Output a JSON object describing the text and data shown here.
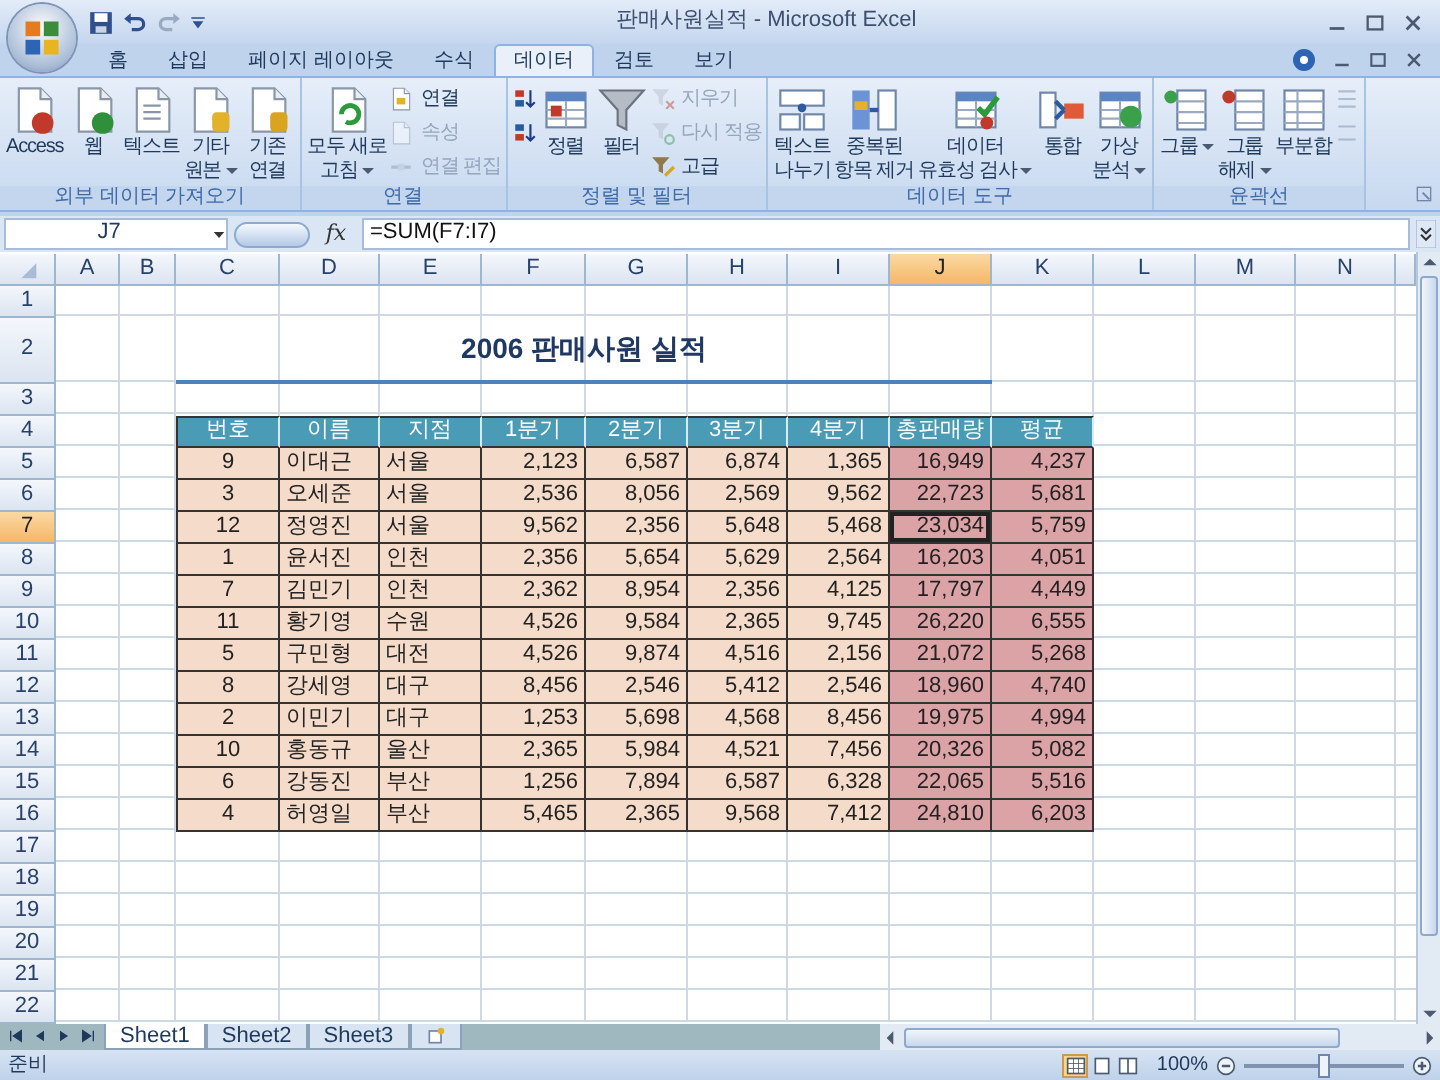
{
  "window": {
    "title": "판매사원실적 - Microsoft Excel"
  },
  "ribbon_tabs": [
    {
      "label": "홈",
      "selected": false
    },
    {
      "label": "삽입",
      "selected": false
    },
    {
      "label": "페이지 레이아웃",
      "selected": false
    },
    {
      "label": "수식",
      "selected": false
    },
    {
      "label": "데이터",
      "selected": true
    },
    {
      "label": "검토",
      "selected": false
    },
    {
      "label": "보기",
      "selected": false
    }
  ],
  "ribbon_groups": [
    {
      "label": "외부 데이터 가져오기",
      "items": [
        {
          "kind": "large",
          "label": "Access",
          "dropdown": false
        },
        {
          "kind": "large",
          "label": "웹",
          "dropdown": false
        },
        {
          "kind": "large",
          "label": "텍스트",
          "dropdown": false
        },
        {
          "kind": "large",
          "label": "기타\n원본",
          "dropdown": true
        },
        {
          "kind": "large",
          "label": "기존\n연결",
          "dropdown": false
        }
      ]
    },
    {
      "label": "연결",
      "items": [
        {
          "kind": "large",
          "label": "모두 새로\n고침",
          "dropdown": true
        },
        {
          "kind": "stack",
          "buttons": [
            {
              "label": "연결",
              "disabled": false
            },
            {
              "label": "속성",
              "disabled": true
            },
            {
              "label": "연결 편집",
              "disabled": true
            }
          ]
        }
      ]
    },
    {
      "label": "정렬 및 필터",
      "items": [
        {
          "kind": "stack",
          "buttons": [
            {
              "disabled": false
            },
            {
              "disabled": false
            }
          ]
        },
        {
          "kind": "large",
          "label": "정렬",
          "dropdown": false
        },
        {
          "kind": "large",
          "label": "필터",
          "dropdown": false
        },
        {
          "kind": "stack",
          "buttons": [
            {
              "label": "지우기",
              "disabled": true
            },
            {
              "label": "다시 적용",
              "disabled": true
            },
            {
              "label": "고급",
              "disabled": false
            }
          ]
        }
      ]
    },
    {
      "label": "데이터 도구",
      "items": [
        {
          "kind": "large",
          "label": "텍스트\n나누기",
          "dropdown": false
        },
        {
          "kind": "large",
          "label": "중복된\n항목 제거",
          "dropdown": false
        },
        {
          "kind": "large",
          "label": "데이터\n유효성 검사",
          "dropdown": true
        },
        {
          "kind": "large",
          "label": "통합",
          "dropdown": false
        },
        {
          "kind": "large",
          "label": "가상\n분석",
          "dropdown": true
        }
      ]
    },
    {
      "label": "윤곽선",
      "items": [
        {
          "kind": "large",
          "label": "그룹",
          "dropdown": true
        },
        {
          "kind": "large",
          "label": "그룹\n해제",
          "dropdown": true
        },
        {
          "kind": "large",
          "label": "부분합",
          "dropdown": false
        },
        {
          "kind": "stack",
          "buttons": [
            {
              "disabled": true
            },
            {
              "disabled": true
            }
          ]
        }
      ]
    }
  ],
  "formula_bar": {
    "name_box": "J7",
    "function_button": "fx",
    "formula": "=SUM(F7:I7)"
  },
  "columns": [
    {
      "label": "A",
      "selected": false
    },
    {
      "label": "B",
      "selected": false
    },
    {
      "label": "C",
      "selected": false
    },
    {
      "label": "D",
      "selected": false
    },
    {
      "label": "E",
      "selected": false
    },
    {
      "label": "F",
      "selected": false
    },
    {
      "label": "G",
      "selected": false
    },
    {
      "label": "H",
      "selected": false
    },
    {
      "label": "I",
      "selected": false
    },
    {
      "label": "J",
      "selected": true
    },
    {
      "label": "K",
      "selected": false
    },
    {
      "label": "L",
      "selected": false
    },
    {
      "label": "M",
      "selected": false
    },
    {
      "label": "N",
      "selected": false
    }
  ],
  "rows": [
    {
      "label": "1",
      "selected": false
    },
    {
      "label": "2",
      "selected": false
    },
    {
      "label": "3",
      "selected": false
    },
    {
      "label": "4",
      "selected": false
    },
    {
      "label": "5",
      "selected": false
    },
    {
      "label": "6",
      "selected": false
    },
    {
      "label": "7",
      "selected": true
    },
    {
      "label": "8",
      "selected": false
    },
    {
      "label": "9",
      "selected": false
    },
    {
      "label": "10",
      "selected": false
    },
    {
      "label": "11",
      "selected": false
    },
    {
      "label": "12",
      "selected": false
    },
    {
      "label": "13",
      "selected": false
    },
    {
      "label": "14",
      "selected": false
    },
    {
      "label": "15",
      "selected": false
    },
    {
      "label": "16",
      "selected": false
    },
    {
      "label": "17",
      "selected": false
    },
    {
      "label": "18",
      "selected": false
    },
    {
      "label": "19",
      "selected": false
    },
    {
      "label": "20",
      "selected": false
    },
    {
      "label": "21",
      "selected": false
    },
    {
      "label": "22",
      "selected": false
    }
  ],
  "table": {
    "title": "2006 판매사원 실적",
    "headers": [
      "번호",
      "이름",
      "지점",
      "1분기",
      "2분기",
      "3분기",
      "4분기",
      "총판매량",
      "평균"
    ],
    "rows": [
      [
        "9",
        "이대근",
        "서울",
        "2,123",
        "6,587",
        "6,874",
        "1,365",
        "16,949",
        "4,237"
      ],
      [
        "3",
        "오세준",
        "서울",
        "2,536",
        "8,056",
        "2,569",
        "9,562",
        "22,723",
        "5,681"
      ],
      [
        "12",
        "정영진",
        "서울",
        "9,562",
        "2,356",
        "5,648",
        "5,468",
        "23,034",
        "5,759"
      ],
      [
        "1",
        "윤서진",
        "인천",
        "2,356",
        "5,654",
        "5,629",
        "2,564",
        "16,203",
        "4,051"
      ],
      [
        "7",
        "김민기",
        "인천",
        "2,362",
        "8,954",
        "2,356",
        "4,125",
        "17,797",
        "4,449"
      ],
      [
        "11",
        "황기영",
        "수원",
        "4,526",
        "9,584",
        "2,365",
        "9,745",
        "26,220",
        "6,555"
      ],
      [
        "5",
        "구민형",
        "대전",
        "4,526",
        "9,874",
        "4,516",
        "2,156",
        "21,072",
        "5,268"
      ],
      [
        "8",
        "강세영",
        "대구",
        "8,456",
        "2,546",
        "5,412",
        "2,546",
        "18,960",
        "4,740"
      ],
      [
        "2",
        "이민기",
        "대구",
        "1,253",
        "5,698",
        "4,568",
        "8,456",
        "19,975",
        "4,994"
      ],
      [
        "10",
        "홍동규",
        "울산",
        "2,365",
        "5,984",
        "4,521",
        "7,456",
        "20,326",
        "5,082"
      ],
      [
        "6",
        "강동진",
        "부산",
        "1,256",
        "7,894",
        "6,587",
        "6,328",
        "22,065",
        "5,516"
      ],
      [
        "4",
        "허영일",
        "부산",
        "5,465",
        "2,365",
        "9,568",
        "7,412",
        "24,810",
        "6,203"
      ]
    ]
  },
  "sheet_tabs": [
    {
      "label": "Sheet1",
      "selected": true
    },
    {
      "label": "Sheet2",
      "selected": false
    },
    {
      "label": "Sheet3",
      "selected": false
    }
  ],
  "status_bar": {
    "mode": "준비",
    "view_buttons": [
      {
        "selected": true
      },
      {
        "selected": false
      },
      {
        "selected": false
      }
    ],
    "zoom": "100%",
    "zoom_slider": {
      "level": 0.5
    }
  }
}
